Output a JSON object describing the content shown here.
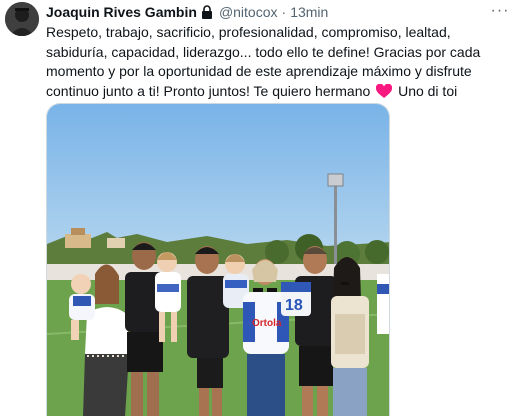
{
  "tweet": {
    "author_name": "Joaquin Rives Gambin",
    "handle": "@nitocox",
    "separator": "·",
    "time": "13min",
    "text_main": "Respeto, trabajo, sacrificio, profesionalidad, compromiso, lealtad, sabiduría, capacidad, liderazgo... todo ello te define! Gracias por cada momento y por la oportunidad de este aprendizaje máximo y disfrute continuo junto a ti! Pronto juntos! Te quiero hermano",
    "text_tail": "Uno di toi",
    "more_label": "···",
    "jersey_number": "18",
    "shirt_sponsor": "Ortola"
  },
  "icons": {
    "lock": "lock-icon",
    "heart": "heart-icon",
    "more": "more-icon"
  },
  "colors": {
    "heart": "#f91880",
    "secondary_text": "#536471",
    "sky": "#8fc1ea",
    "grass": "#6ea34e"
  }
}
